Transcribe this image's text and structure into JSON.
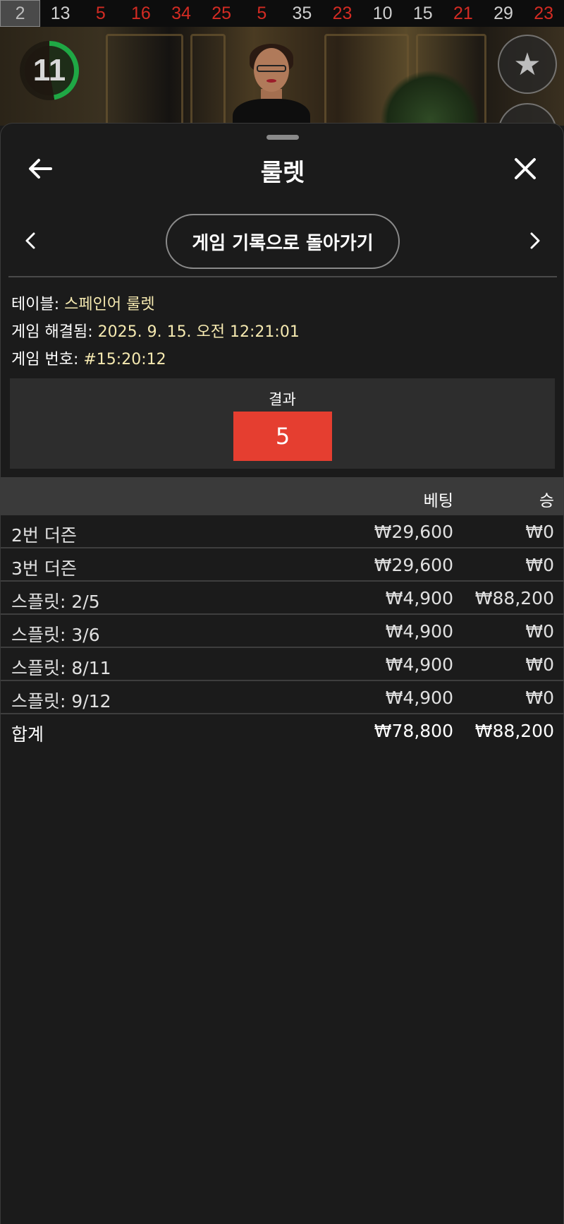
{
  "history": [
    {
      "num": "2",
      "color": "current"
    },
    {
      "num": "13",
      "color": "black"
    },
    {
      "num": "5",
      "color": "red"
    },
    {
      "num": "16",
      "color": "red"
    },
    {
      "num": "34",
      "color": "red"
    },
    {
      "num": "25",
      "color": "red"
    },
    {
      "num": "5",
      "color": "red"
    },
    {
      "num": "35",
      "color": "black"
    },
    {
      "num": "23",
      "color": "red"
    },
    {
      "num": "10",
      "color": "black"
    },
    {
      "num": "15",
      "color": "black"
    },
    {
      "num": "21",
      "color": "red"
    },
    {
      "num": "29",
      "color": "black"
    },
    {
      "num": "23",
      "color": "red"
    }
  ],
  "timer": {
    "value": "11"
  },
  "sheet": {
    "title": "룰렛",
    "back_history_label": "게임 기록으로 돌아가기"
  },
  "info": {
    "table_label": "테이블: ",
    "table_value": "스페인어 룰렛",
    "resolved_label": "게임 해결됨: ",
    "resolved_value": "2025. 9. 15. 오전 12:21:01",
    "number_label": "게임 번호: ",
    "number_value": "#15:20:12"
  },
  "result": {
    "label": "결과",
    "number": "5",
    "color": "#e53e30"
  },
  "bets_table": {
    "headers": {
      "bet": "베팅",
      "win": "승"
    },
    "rows": [
      {
        "name": "2번 더즌",
        "bet": "₩29,600",
        "win": "₩0"
      },
      {
        "name": "3번 더즌",
        "bet": "₩29,600",
        "win": "₩0"
      },
      {
        "name": "스플릿: 2/5",
        "bet": "₩4,900",
        "win": "₩88,200"
      },
      {
        "name": "스플릿: 3/6",
        "bet": "₩4,900",
        "win": "₩0"
      },
      {
        "name": "스플릿: 8/11",
        "bet": "₩4,900",
        "win": "₩0"
      },
      {
        "name": "스플릿: 9/12",
        "bet": "₩4,900",
        "win": "₩0"
      }
    ],
    "total": {
      "name": "합계",
      "bet": "₩78,800",
      "win": "₩88,200"
    }
  },
  "colors": {
    "red": "#d32b23",
    "accent_green": "#1fa845",
    "highlight_text": "#f5e9b0"
  }
}
